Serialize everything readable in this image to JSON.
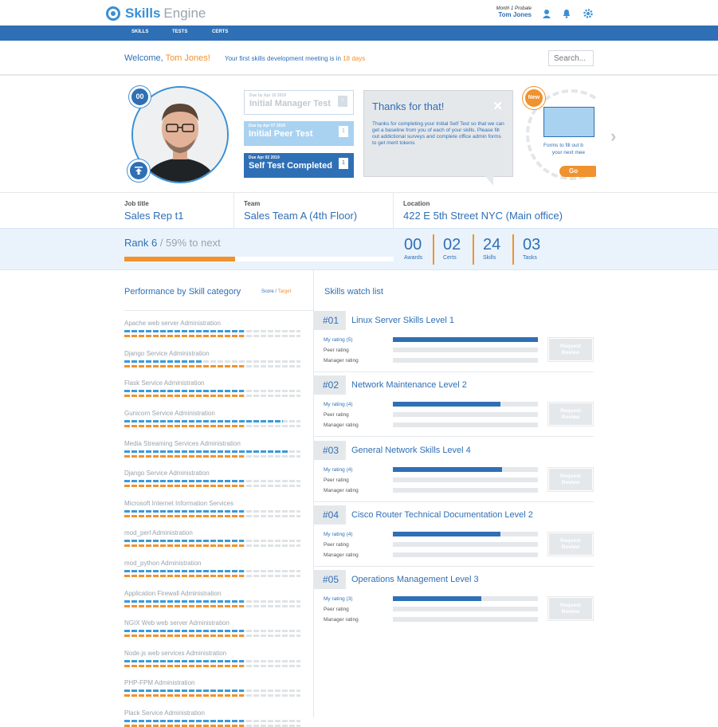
{
  "header": {
    "logo_skills": "Skills",
    "logo_engine": "Engine",
    "probate": "Month 1 Probate",
    "user_name": "Tom Jones"
  },
  "nav": [
    "SKILLS",
    "TESTS",
    "CERTS"
  ],
  "welcome": {
    "prefix": "Welcome, ",
    "name": "Tom Jones!",
    "meeting_prefix": "Your first skills development meeting is in ",
    "meeting_days": "18 days"
  },
  "search": {
    "placeholder": "Search..."
  },
  "profile": {
    "awards_badge": "00"
  },
  "tests": [
    {
      "due": "Due by Apr 15 2019",
      "title": "Initial Manager Test",
      "count": "!"
    },
    {
      "due": "Due by Apr 07 2019",
      "title": "Initial Peer Test",
      "count": "1"
    },
    {
      "due": "Due Apr 02 2019",
      "title": "Self Test Completed",
      "count": "1"
    }
  ],
  "popup": {
    "title": "Thanks for that!",
    "close": "✕",
    "body": "Thanks for completing your Initial Self Test so that we can get a baseline from you of each of your skills. Please fill out addictional surveys and complete office admin forms to get merit tokens"
  },
  "new_card": {
    "badge": "New",
    "text_line1": "Forms to fill out b",
    "text_line2": "your next mee",
    "go": "Go"
  },
  "info": {
    "job_label": "Job title",
    "job_value": "Sales Rep t1",
    "team_label": "Team",
    "team_value": "Sales Team A (4th Floor)",
    "location_label": "Location",
    "location_value": "422 E 5th Street NYC (Main office)"
  },
  "rank": {
    "rank_text": "Rank 6",
    "pct_text": "/ 59% to next",
    "progress": 0.41
  },
  "stats": [
    {
      "num": "00",
      "label": "Awards"
    },
    {
      "num": "02",
      "label": "Certs"
    },
    {
      "num": "24",
      "label": "Skills"
    },
    {
      "num": "03",
      "label": "Tasks"
    }
  ],
  "performance": {
    "title": "Performance by Skill category",
    "legend_score": "Score",
    "legend_sep": " / ",
    "legend_target": "Target",
    "skills": [
      {
        "name": "Apache web server Administration",
        "score": 0.68,
        "target": 0.68
      },
      {
        "name": "Django Service Administration",
        "score": 0.45,
        "target": 0.68
      },
      {
        "name": "Flask Service Administration",
        "score": 0.68,
        "target": 0.68
      },
      {
        "name": "Gunicorn Service Administration",
        "score": 0.9,
        "target": 0.68
      },
      {
        "name": "Media Streaming Services Administration",
        "score": 0.93,
        "target": 0.68
      },
      {
        "name": "Django Service Administration",
        "score": 0.68,
        "target": 0.68
      },
      {
        "name": "Microsoft Internet Information Services",
        "score": 0.68,
        "target": 0.68
      },
      {
        "name": "mod_perl Administration",
        "score": 0.68,
        "target": 0.68
      },
      {
        "name": "mod_python Administration",
        "score": 0.68,
        "target": 0.68
      },
      {
        "name": "Application Firewall Administration",
        "score": 0.68,
        "target": 0.68
      },
      {
        "name": "NGIX Web web server Administration",
        "score": 0.68,
        "target": 0.68
      },
      {
        "name": "Node.js web services Administration",
        "score": 0.68,
        "target": 0.68
      },
      {
        "name": "PHP-FPM Administration",
        "score": 0.68,
        "target": 0.68
      },
      {
        "name": "Plack Service Administration",
        "score": 0.68,
        "target": 0.68
      }
    ]
  },
  "watchlist": {
    "title": "Skills watch list",
    "peer_label": "Peer rating",
    "manager_label": "Manager rating",
    "request_label_1": "Request",
    "request_label_2": "Review",
    "items": [
      {
        "num": "#01",
        "name": "Linux Server Skills Level 1",
        "my_label": "My rating (5)",
        "my": 1.0
      },
      {
        "num": "#02",
        "name": "Network Maintenance Level 2",
        "my_label": "My rating (4)",
        "my": 0.74
      },
      {
        "num": "#03",
        "name": "General Network Skills Level 4",
        "my_label": "My rating (4)",
        "my": 0.75
      },
      {
        "num": "#04",
        "name": "Cisco Router Technical Documentation  Level 2",
        "my_label": "My rating (4)",
        "my": 0.74
      },
      {
        "num": "#05",
        "name": "Operations Management Level 3",
        "my_label": "My rating (3)",
        "my": 0.61
      }
    ]
  },
  "colors": {
    "brand": "#2f6fb5",
    "accent": "#f0922e",
    "light": "#3a9ad9"
  }
}
